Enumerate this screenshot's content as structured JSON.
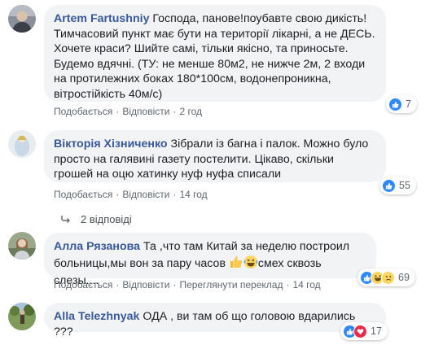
{
  "comments": [
    {
      "author": "Artem Fartushniy",
      "text": "Господа, панове!поубавте свою дикість! Тимчасовий пункт має бути на території лікарні, а не ДЕСЬ. Хочете краси? Шийте самі, тільки якісно, та приносьте. Будемо вдячні. (ТУ: не менше 80м2, не нижче 2м, 2 входи на протилежних боках 180*100см, водонепроникна, вітростійкість 40м/с)",
      "like_label": "Подобається",
      "reply_label": "Відповісти",
      "time": "2 год",
      "reactions": [
        "like"
      ],
      "reaction_count": "7"
    },
    {
      "author": "Вікторія Хізниченко",
      "text": "Зібрали із багна і палок. Можно було просто на галявині газету постелити. Цікаво, скільки грошей на оцю хатинку нуф нуфа списали",
      "like_label": "Подобається",
      "reply_label": "Відповісти",
      "time": "14 год",
      "reactions": [
        "like"
      ],
      "reaction_count": "55"
    },
    {
      "author": "Алла Рязанова",
      "text_part1": "Та ,что там Китай за неделю построил больницы,мы вон за пару часов ",
      "text_part2": "смех сквозь слезы....",
      "like_label": "Подобається",
      "reply_label": "Відповісти",
      "translate_label": "Переглянути переклад",
      "time": "14 год",
      "reactions": [
        "like",
        "haha",
        "sad"
      ],
      "reaction_count": "69"
    },
    {
      "author": "Alla Telezhnyak",
      "text": "ОДА , ви там об що головою вдарились ???",
      "reactions": [
        "like",
        "love"
      ],
      "reaction_count": "17"
    }
  ],
  "replies_toggle": {
    "label": "2 відповіді",
    "icon": "reply-arrow-icon"
  },
  "colors": {
    "author": "#385898",
    "bubble": "#f2f3f5",
    "meta": "#606770",
    "like": "#2e89ff",
    "love": "#f0284a"
  }
}
